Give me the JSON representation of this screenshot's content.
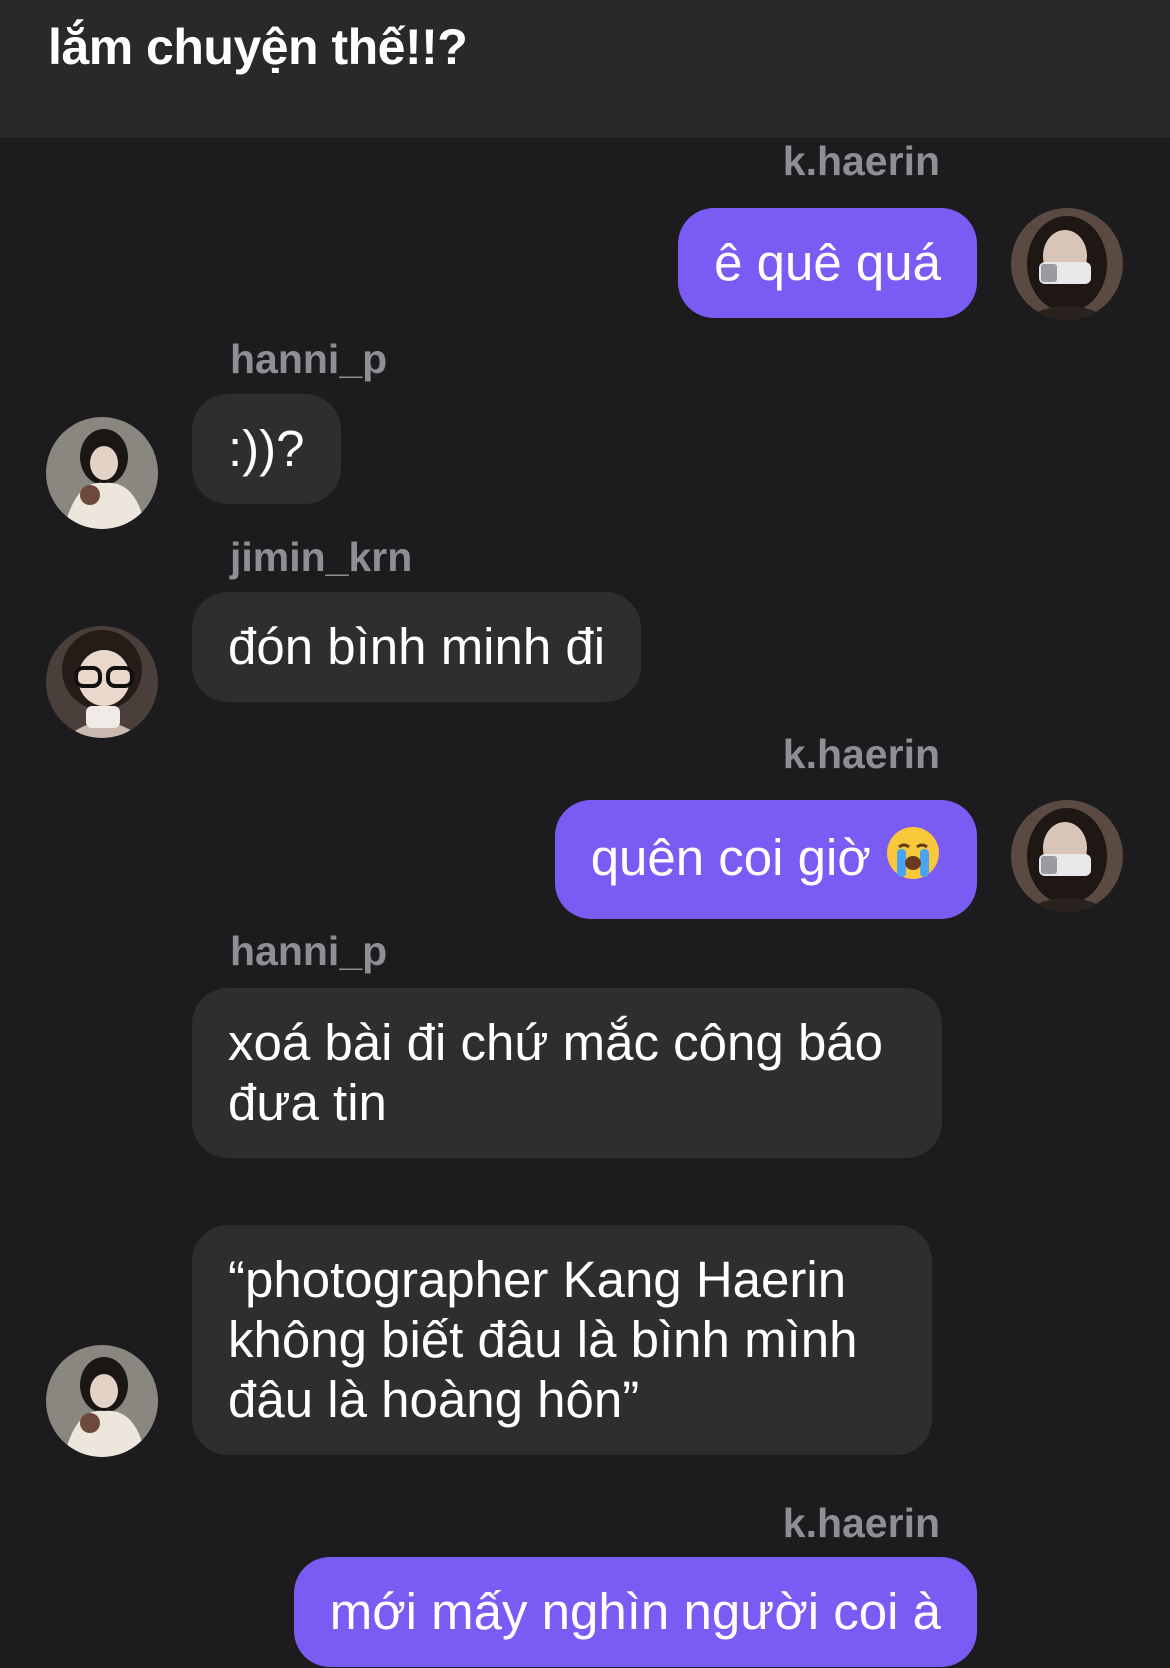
{
  "header": {
    "title": "lắm chuyện thế!!?"
  },
  "messages": [
    {
      "user": "k.haerin",
      "text": "ê quê quá"
    },
    {
      "user": "hanni_p",
      "text": ":))?"
    },
    {
      "user": "jimin_krn",
      "text": "đón bình minh đi"
    },
    {
      "user": "k.haerin",
      "text": "quên coi giờ",
      "emoji": "crying-face-emoji"
    },
    {
      "user": "hanni_p",
      "text": "xoá bài đi chứ mắc công báo đưa tin"
    },
    {
      "user": "",
      "text": "“photographer Kang Haerin không biết đâu là bình mình đâu là hoàng hôn”"
    },
    {
      "user": "k.haerin",
      "text": "mới mấy nghìn người coi à"
    }
  ],
  "colors": {
    "outgoing_bubble": "#7a5cf5",
    "incoming_bubble": "#2e2e30",
    "background": "#1c1c1e",
    "header": "#29292b",
    "username": "#8e8e93"
  }
}
